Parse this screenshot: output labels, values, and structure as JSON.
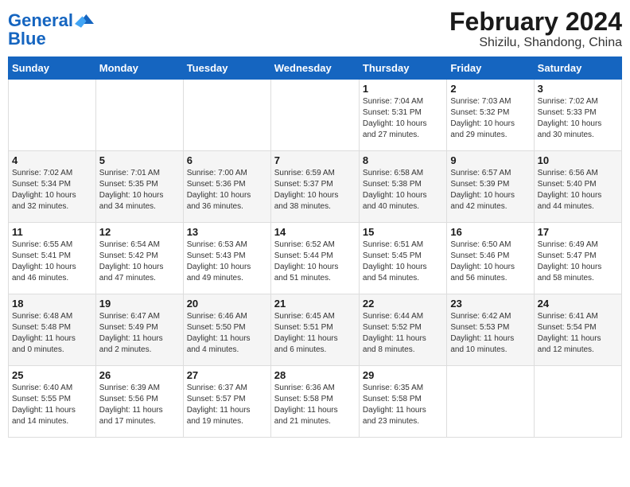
{
  "header": {
    "logo_line1": "General",
    "logo_line2": "Blue",
    "title": "February 2024",
    "subtitle": "Shizilu, Shandong, China"
  },
  "weekdays": [
    "Sunday",
    "Monday",
    "Tuesday",
    "Wednesday",
    "Thursday",
    "Friday",
    "Saturday"
  ],
  "weeks": [
    [
      {
        "day": "",
        "info": ""
      },
      {
        "day": "",
        "info": ""
      },
      {
        "day": "",
        "info": ""
      },
      {
        "day": "",
        "info": ""
      },
      {
        "day": "1",
        "info": "Sunrise: 7:04 AM\nSunset: 5:31 PM\nDaylight: 10 hours\nand 27 minutes."
      },
      {
        "day": "2",
        "info": "Sunrise: 7:03 AM\nSunset: 5:32 PM\nDaylight: 10 hours\nand 29 minutes."
      },
      {
        "day": "3",
        "info": "Sunrise: 7:02 AM\nSunset: 5:33 PM\nDaylight: 10 hours\nand 30 minutes."
      }
    ],
    [
      {
        "day": "4",
        "info": "Sunrise: 7:02 AM\nSunset: 5:34 PM\nDaylight: 10 hours\nand 32 minutes."
      },
      {
        "day": "5",
        "info": "Sunrise: 7:01 AM\nSunset: 5:35 PM\nDaylight: 10 hours\nand 34 minutes."
      },
      {
        "day": "6",
        "info": "Sunrise: 7:00 AM\nSunset: 5:36 PM\nDaylight: 10 hours\nand 36 minutes."
      },
      {
        "day": "7",
        "info": "Sunrise: 6:59 AM\nSunset: 5:37 PM\nDaylight: 10 hours\nand 38 minutes."
      },
      {
        "day": "8",
        "info": "Sunrise: 6:58 AM\nSunset: 5:38 PM\nDaylight: 10 hours\nand 40 minutes."
      },
      {
        "day": "9",
        "info": "Sunrise: 6:57 AM\nSunset: 5:39 PM\nDaylight: 10 hours\nand 42 minutes."
      },
      {
        "day": "10",
        "info": "Sunrise: 6:56 AM\nSunset: 5:40 PM\nDaylight: 10 hours\nand 44 minutes."
      }
    ],
    [
      {
        "day": "11",
        "info": "Sunrise: 6:55 AM\nSunset: 5:41 PM\nDaylight: 10 hours\nand 46 minutes."
      },
      {
        "day": "12",
        "info": "Sunrise: 6:54 AM\nSunset: 5:42 PM\nDaylight: 10 hours\nand 47 minutes."
      },
      {
        "day": "13",
        "info": "Sunrise: 6:53 AM\nSunset: 5:43 PM\nDaylight: 10 hours\nand 49 minutes."
      },
      {
        "day": "14",
        "info": "Sunrise: 6:52 AM\nSunset: 5:44 PM\nDaylight: 10 hours\nand 51 minutes."
      },
      {
        "day": "15",
        "info": "Sunrise: 6:51 AM\nSunset: 5:45 PM\nDaylight: 10 hours\nand 54 minutes."
      },
      {
        "day": "16",
        "info": "Sunrise: 6:50 AM\nSunset: 5:46 PM\nDaylight: 10 hours\nand 56 minutes."
      },
      {
        "day": "17",
        "info": "Sunrise: 6:49 AM\nSunset: 5:47 PM\nDaylight: 10 hours\nand 58 minutes."
      }
    ],
    [
      {
        "day": "18",
        "info": "Sunrise: 6:48 AM\nSunset: 5:48 PM\nDaylight: 11 hours\nand 0 minutes."
      },
      {
        "day": "19",
        "info": "Sunrise: 6:47 AM\nSunset: 5:49 PM\nDaylight: 11 hours\nand 2 minutes."
      },
      {
        "day": "20",
        "info": "Sunrise: 6:46 AM\nSunset: 5:50 PM\nDaylight: 11 hours\nand 4 minutes."
      },
      {
        "day": "21",
        "info": "Sunrise: 6:45 AM\nSunset: 5:51 PM\nDaylight: 11 hours\nand 6 minutes."
      },
      {
        "day": "22",
        "info": "Sunrise: 6:44 AM\nSunset: 5:52 PM\nDaylight: 11 hours\nand 8 minutes."
      },
      {
        "day": "23",
        "info": "Sunrise: 6:42 AM\nSunset: 5:53 PM\nDaylight: 11 hours\nand 10 minutes."
      },
      {
        "day": "24",
        "info": "Sunrise: 6:41 AM\nSunset: 5:54 PM\nDaylight: 11 hours\nand 12 minutes."
      }
    ],
    [
      {
        "day": "25",
        "info": "Sunrise: 6:40 AM\nSunset: 5:55 PM\nDaylight: 11 hours\nand 14 minutes."
      },
      {
        "day": "26",
        "info": "Sunrise: 6:39 AM\nSunset: 5:56 PM\nDaylight: 11 hours\nand 17 minutes."
      },
      {
        "day": "27",
        "info": "Sunrise: 6:37 AM\nSunset: 5:57 PM\nDaylight: 11 hours\nand 19 minutes."
      },
      {
        "day": "28",
        "info": "Sunrise: 6:36 AM\nSunset: 5:58 PM\nDaylight: 11 hours\nand 21 minutes."
      },
      {
        "day": "29",
        "info": "Sunrise: 6:35 AM\nSunset: 5:58 PM\nDaylight: 11 hours\nand 23 minutes."
      },
      {
        "day": "",
        "info": ""
      },
      {
        "day": "",
        "info": ""
      }
    ]
  ]
}
